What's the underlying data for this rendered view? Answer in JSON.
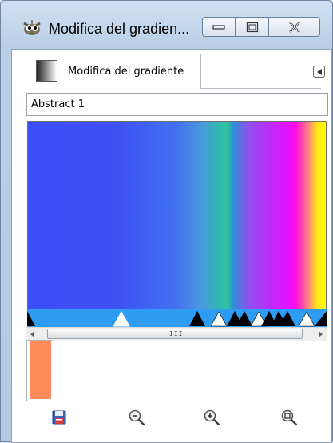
{
  "window": {
    "title": "Modifica del gradien...",
    "icon": "gimp-wilber-icon"
  },
  "caption_buttons": [
    "minimize-icon",
    "maximize-icon",
    "close-icon"
  ],
  "tab": {
    "label": "Modifica del gradiente",
    "icon": "gradient-icon"
  },
  "gradient": {
    "name": "Abstract 1",
    "colors": {
      "start": "#3c4ef6",
      "teal": "#2fc59c",
      "violet": "#9050ee",
      "magenta": "#e012ff",
      "yellow": "#ffff00"
    },
    "handle_bar_color": "#2f9cf4",
    "current_color": "#ff8a5c"
  },
  "scrollbar": {
    "grip": "III"
  },
  "toolbar": {
    "buttons": [
      "save-icon",
      "zoom-out-icon",
      "zoom-in-icon",
      "zoom-fit-icon"
    ]
  }
}
